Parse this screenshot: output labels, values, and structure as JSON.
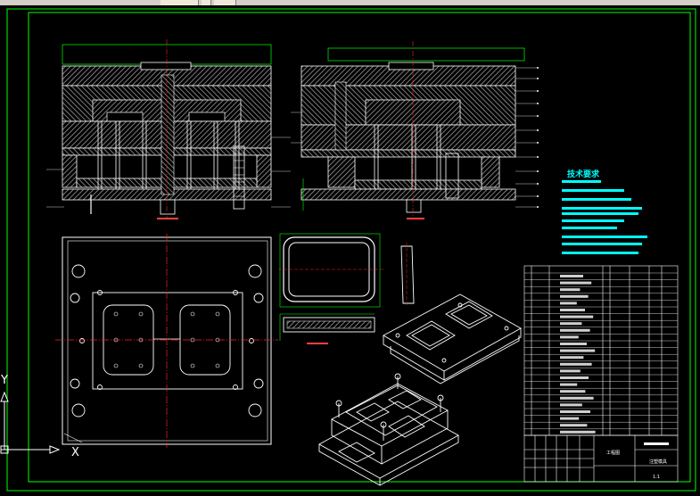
{
  "window": {
    "toolbar_segments": 3
  },
  "tech": {
    "heading": "技术要求"
  },
  "titleblock": {
    "company": "工程图",
    "drawing_name": "注塑模具",
    "scale": "1:1"
  },
  "axes": {
    "x_label": "X",
    "y_label": "Y"
  },
  "colors": {
    "background": "#000000",
    "border": "#00ff00",
    "line": "#ffffff",
    "hatch": "#888888",
    "center": "#ff2020",
    "note": "#00ffff",
    "dim": "#00ff00"
  }
}
